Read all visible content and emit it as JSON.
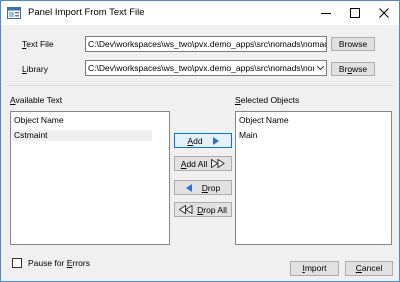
{
  "window": {
    "title": "Panel Import From Text File",
    "icons": {
      "app": "panel-window-icon",
      "minimize": "minimize-icon",
      "maximize": "maximize-icon",
      "close": "close-icon"
    }
  },
  "text_file": {
    "label_prefix": "",
    "label_mnemonic": "T",
    "label_rest": "ext File",
    "value": "C:\\Dev\\workspaces\\ws_two\\pvx.demo_apps\\src\\nomads\\nomadlib.txt",
    "browse_label": "Browse"
  },
  "library": {
    "label_prefix": "",
    "label_mnemonic": "L",
    "label_rest": "ibrary",
    "value": "C:\\Dev\\workspaces\\ws_two\\pvx.demo_apps\\src\\nomads\\nomadlib",
    "browse_prefix": "Br",
    "browse_mnemonic": "o",
    "browse_rest": "wse"
  },
  "available": {
    "label_prefix": "",
    "label_mnemonic": "A",
    "label_rest": "vailable Text",
    "column_header": "Object Name",
    "items": [
      "Cstmaint"
    ]
  },
  "selected": {
    "label_prefix": "",
    "label_mnemonic": "S",
    "label_rest": "elected Objects",
    "column_header": "Object Name",
    "items": [
      "Main"
    ]
  },
  "buttons": {
    "add_mnemonic": "A",
    "add_rest": "dd",
    "add_all_mnemonic": "A",
    "add_all_rest": "dd All",
    "drop_mnemonic": "D",
    "drop_rest": "rop",
    "drop_all_mnemonic": "D",
    "drop_all_rest": "rop All",
    "import_mnemonic": "I",
    "import_rest": "mport",
    "cancel_mnemonic": "C",
    "cancel_rest": "ancel"
  },
  "pause": {
    "label_prefix": "Pause for ",
    "label_mnemonic": "E",
    "label_rest": "rrors",
    "checked": false
  },
  "colors": {
    "accent": "#0078d7",
    "arrow_blue": "#2f6fd6",
    "window_border": "#4a8ad6"
  }
}
